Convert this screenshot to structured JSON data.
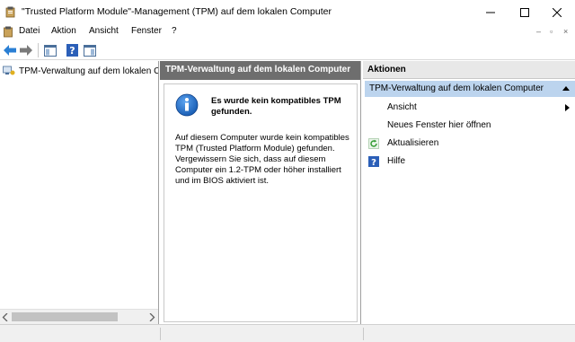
{
  "window": {
    "title": "\"Trusted Platform Module\"-Management (TPM) auf dem lokalen Computer",
    "minimize_icon": "minimize-icon",
    "maximize_icon": "maximize-icon",
    "close_icon": "close-icon"
  },
  "menubar": {
    "items": [
      "Datei",
      "Aktion",
      "Ansicht",
      "Fenster",
      "?"
    ],
    "mdi_controls": [
      "–",
      "▫",
      "×"
    ]
  },
  "toolbar": {
    "buttons": [
      "back-arrow-icon",
      "forward-arrow-icon",
      "show-hide-tree-icon",
      "help-icon",
      "show-hide-action-pane-icon"
    ]
  },
  "tree": {
    "root_label": "TPM-Verwaltung auf dem lokalen Computer"
  },
  "center": {
    "header": "TPM-Verwaltung auf dem lokalen Computer",
    "message_title": "Es wurde kein kompatibles TPM gefunden.",
    "message_body": "Auf diesem Computer wurde kein kompatibles TPM (Trusted Platform Module) gefunden. Vergewissern Sie sich, dass auf diesem Computer ein 1.2-TPM oder höher installiert und im BIOS aktiviert ist."
  },
  "actions": {
    "header": "Aktionen",
    "section_title": "TPM-Verwaltung auf dem lokalen Computer",
    "items": [
      {
        "label": "Ansicht",
        "icon": "",
        "submenu": true
      },
      {
        "label": "Neues Fenster hier öffnen",
        "icon": ""
      },
      {
        "label": "Aktualisieren",
        "icon": "refresh-icon"
      },
      {
        "label": "Hilfe",
        "icon": "help-icon"
      }
    ]
  },
  "colors": {
    "pane_header": "#6e6e6e",
    "section_highlight": "#bcd4ee",
    "info_blue": "#1c6bc7"
  }
}
